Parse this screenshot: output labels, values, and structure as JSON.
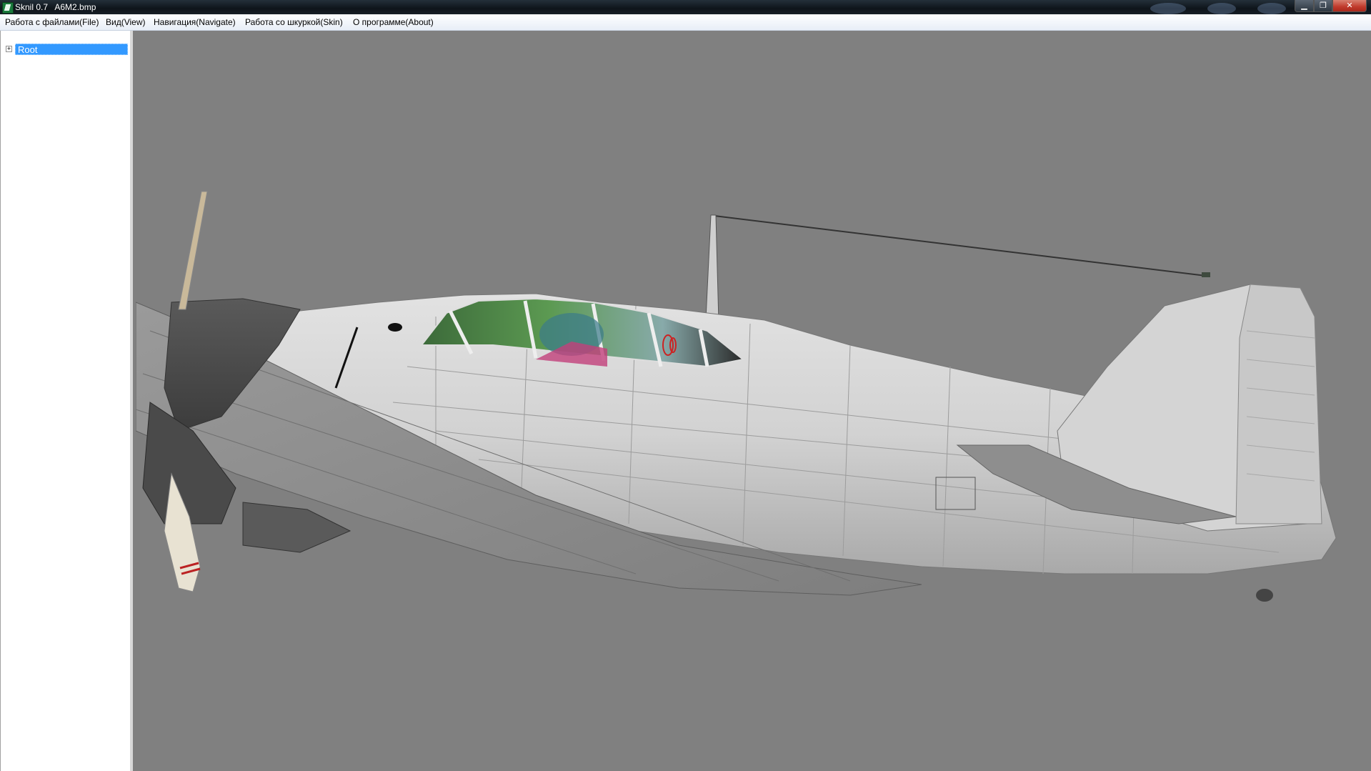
{
  "window": {
    "title": "Sknil 0.7   A6M2.bmp",
    "min_glyph": "▁",
    "max_glyph": "❐",
    "close_glyph": "✕"
  },
  "menu": [
    {
      "label": "Работа с файлами(File)"
    },
    {
      "label": "Вид(View)"
    },
    {
      "label": "Навигация(Navigate)"
    },
    {
      "label": "Работа со шкуркой(Skin)"
    },
    {
      "label": "О программе(About)"
    }
  ],
  "tree": {
    "root_label": "Root",
    "expander": "+"
  },
  "viewport": {
    "background": "#808080",
    "model": "aircraft-3d-model"
  }
}
